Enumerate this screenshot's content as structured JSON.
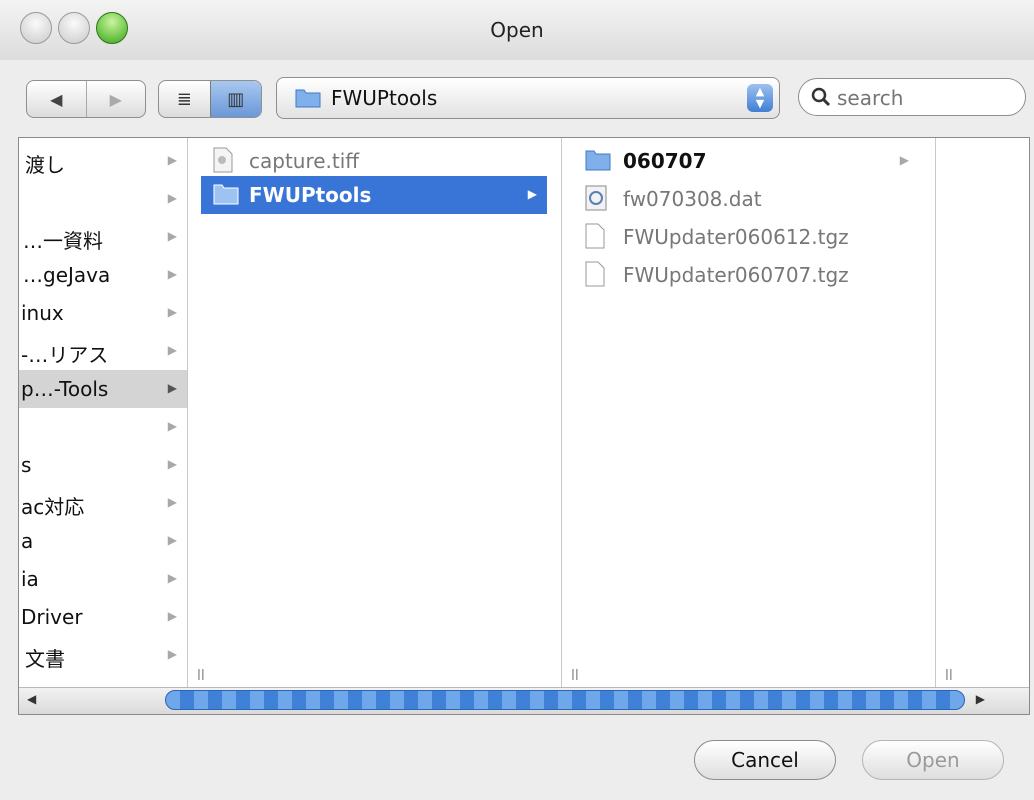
{
  "window": {
    "title": "Open"
  },
  "toolbar": {
    "back_glyph": "◀",
    "forward_glyph": "▶",
    "list_view_glyph": "≣",
    "column_view_glyph": "▥",
    "path": "FWUPtools",
    "path_arrows": "▲▼",
    "search_placeholder": "search"
  },
  "columns": {
    "col1": [
      {
        "label": "渡し",
        "selected": false
      },
      {
        "label": "",
        "selected": false
      },
      {
        "label": "…一資料",
        "selected": false
      },
      {
        "label": "…geJava",
        "selected": false
      },
      {
        "label": "inux",
        "selected": false
      },
      {
        "label": "-…リアス",
        "selected": false
      },
      {
        "label": "p…-Tools",
        "selected": true
      },
      {
        "label": "",
        "selected": false
      },
      {
        "label": "s",
        "selected": false
      },
      {
        "label": "ac対応",
        "selected": false
      },
      {
        "label": "a",
        "selected": false
      },
      {
        "label": "ia",
        "selected": false
      },
      {
        "label": "Driver",
        "selected": false
      },
      {
        "label": "文書",
        "selected": false
      }
    ],
    "col2": [
      {
        "label": "capture.tiff",
        "type": "image",
        "selected": false
      },
      {
        "label": "FWUPtools",
        "type": "folder",
        "selected": true
      }
    ],
    "col3": [
      {
        "label": "060707",
        "type": "folder"
      },
      {
        "label": "fw070308.dat",
        "type": "data"
      },
      {
        "label": "FWUpdater060612.tgz",
        "type": "document"
      },
      {
        "label": "FWUpdater060707.tgz",
        "type": "document"
      }
    ]
  },
  "buttons": {
    "cancel": "Cancel",
    "open": "Open"
  },
  "colors": {
    "selection": "#3875d7",
    "zoom": "#3aa51c"
  }
}
